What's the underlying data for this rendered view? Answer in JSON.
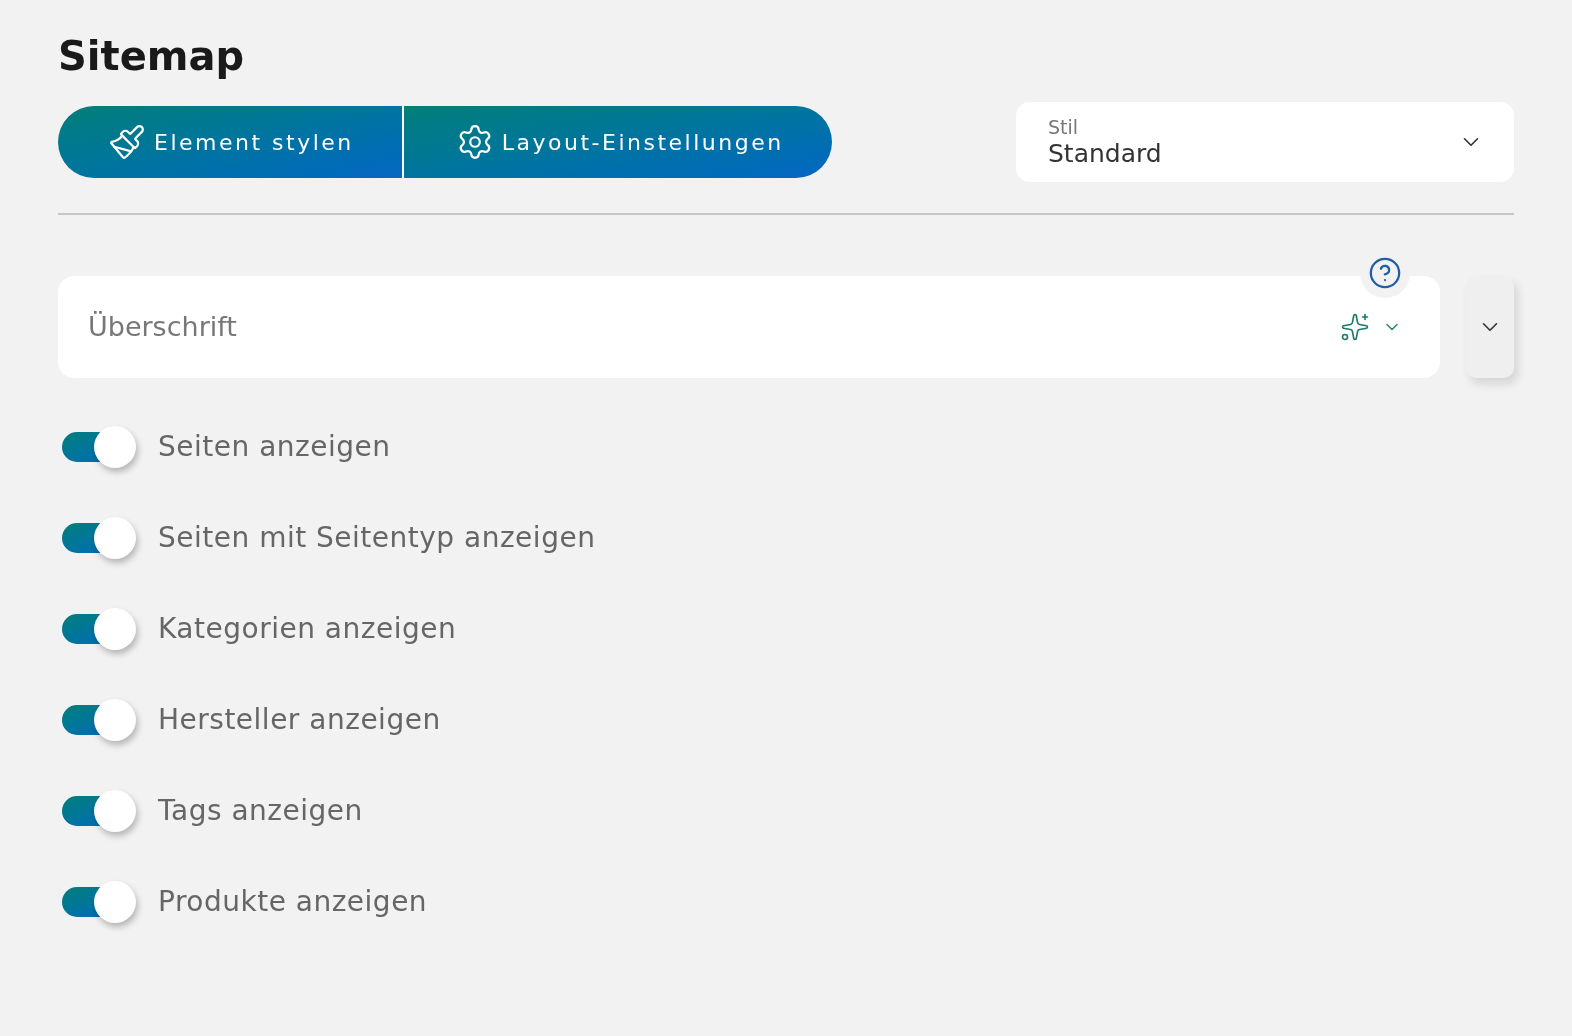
{
  "title": "Sitemap",
  "tabs": [
    {
      "label": "Element stylen",
      "kind": "brush"
    },
    {
      "label": "Layout-Einstellungen",
      "kind": "gear"
    }
  ],
  "style_select": {
    "label": "Stil",
    "value": "Standard"
  },
  "heading_field": {
    "placeholder": "Überschrift"
  },
  "toggles": [
    {
      "label": "Seiten anzeigen",
      "on": true
    },
    {
      "label": "Seiten mit Seitentyp anzeigen",
      "on": true
    },
    {
      "label": "Kategorien anzeigen",
      "on": true
    },
    {
      "label": "Hersteller anzeigen",
      "on": true
    },
    {
      "label": "Tags anzeigen",
      "on": true
    },
    {
      "label": "Produkte anzeigen",
      "on": true
    }
  ]
}
